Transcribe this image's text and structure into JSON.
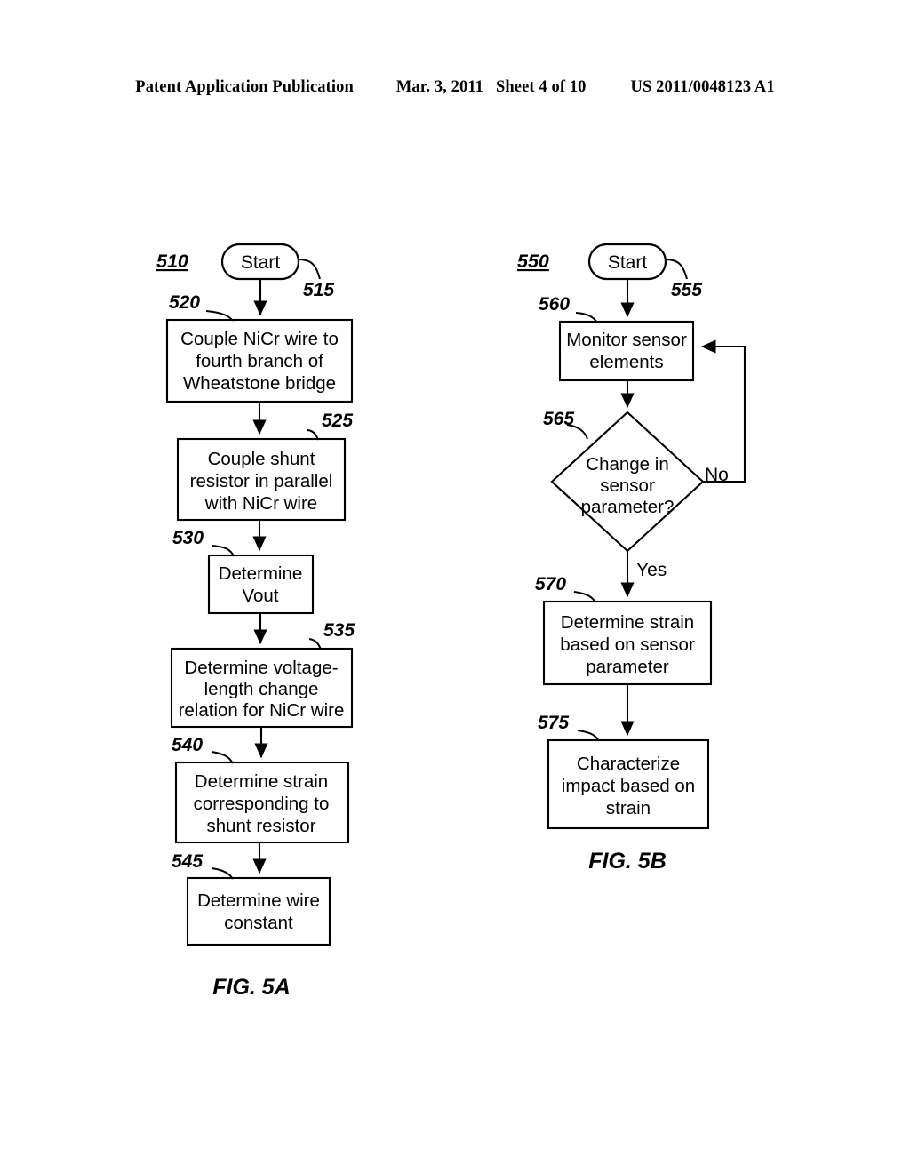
{
  "header": {
    "publication": "Patent Application Publication",
    "date": "Mar. 3, 2011",
    "sheet": "Sheet 4 of 10",
    "patent_number": "US 2011/0048123 A1"
  },
  "figures": [
    {
      "label": "FIG. 5A",
      "flow_ref": "510",
      "nodes": [
        {
          "ref": "515",
          "type": "terminator",
          "text": "Start"
        },
        {
          "ref": "520",
          "type": "process",
          "lines": [
            "Couple NiCr wire to",
            "fourth branch of",
            "Wheatstone bridge"
          ]
        },
        {
          "ref": "525",
          "type": "process",
          "lines": [
            "Couple shunt",
            "resistor in parallel",
            "with NiCr wire"
          ]
        },
        {
          "ref": "530",
          "type": "process",
          "lines": [
            "Determine",
            "Vout"
          ]
        },
        {
          "ref": "535",
          "type": "process",
          "lines": [
            "Determine voltage-",
            "length change",
            "relation for NiCr wire"
          ]
        },
        {
          "ref": "540",
          "type": "process",
          "lines": [
            "Determine strain",
            "corresponding to",
            "shunt resistor"
          ]
        },
        {
          "ref": "545",
          "type": "process",
          "lines": [
            "Determine wire",
            "constant"
          ]
        }
      ]
    },
    {
      "label": "FIG. 5B",
      "flow_ref": "550",
      "nodes": [
        {
          "ref": "555",
          "type": "terminator",
          "text": "Start"
        },
        {
          "ref": "560",
          "type": "process",
          "lines": [
            "Monitor sensor",
            "elements"
          ]
        },
        {
          "ref": "565",
          "type": "decision",
          "lines": [
            "Change in",
            "sensor",
            "parameter?"
          ],
          "branch_no": "No",
          "branch_yes": "Yes"
        },
        {
          "ref": "570",
          "type": "process",
          "lines": [
            "Determine strain",
            "based on sensor",
            "parameter"
          ]
        },
        {
          "ref": "575",
          "type": "process",
          "lines": [
            "Characterize",
            "impact based on",
            "strain"
          ]
        }
      ]
    }
  ]
}
